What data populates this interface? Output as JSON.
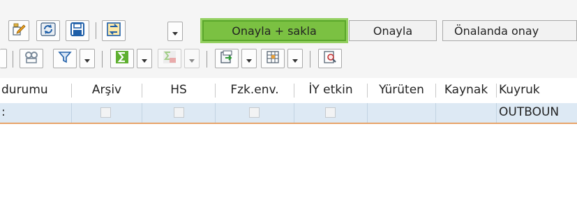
{
  "toolbar": {
    "buttons": {
      "approve_and_save": "Onayla + sakla",
      "approve": "Onayla",
      "pre_approve": "Önalanda onay"
    },
    "icons_row1": [
      "edit-object-icon",
      "refresh-icon",
      "save-icon",
      "transfer-icon"
    ],
    "icons_row2": [
      "details-icon",
      "filter-icon",
      "sum-icon",
      "subtotal-icon",
      "export-icon",
      "layout-icon",
      "find-icon"
    ]
  },
  "table": {
    "columns": [
      "durumu",
      "Arşiv",
      "HS",
      "Fzk.env.",
      "İY etkin",
      "Yürüten",
      "Kaynak",
      "Kuyruk"
    ],
    "rows": [
      {
        "first_cell": ":",
        "arsiv": false,
        "hs": false,
        "fzk_env": false,
        "iy_etkin": false,
        "yuruten": "",
        "kaynak": "",
        "kuyruk": "OUTBOUN"
      }
    ]
  },
  "colors": {
    "primary_button": "#7bc142",
    "selected_row": "#dde9f4",
    "row_underline": "#e8a368"
  }
}
